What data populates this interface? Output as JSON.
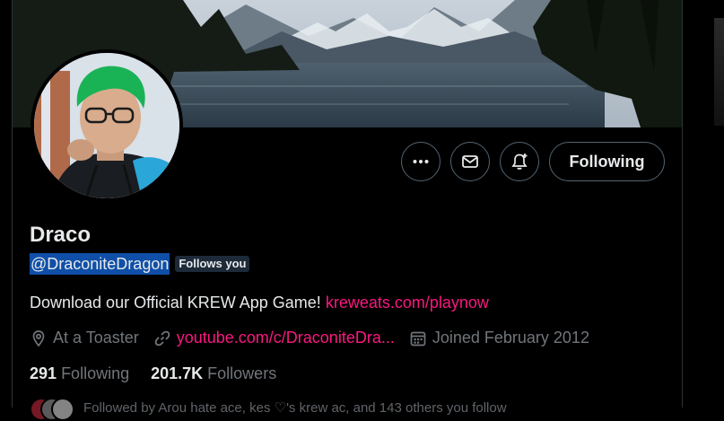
{
  "profile": {
    "name": "Draco",
    "handle": "@DraconiteDragon",
    "follows_you": "Follows you",
    "bio_text": "Download our Official KREW App Game!",
    "bio_link": "kreweats.com/playnow",
    "location": "At a Toaster",
    "website": "youtube.com/c/DraconiteDra...",
    "joined": "Joined February 2012",
    "following_count": "291",
    "following_label": "Following",
    "followers_count": "201.7K",
    "followers_label": "Followers",
    "followed_by": "Followed by Arou hate ace, kes ♡'s krew ac, and 143 others you follow"
  },
  "actions": {
    "follow_button": "Following"
  },
  "icons": {
    "more": "more-horizontal-icon",
    "message": "envelope-icon",
    "notify": "bell-plus-icon",
    "location": "location-pin-icon",
    "link": "link-icon",
    "calendar": "calendar-icon"
  },
  "colors": {
    "background": "#000000",
    "text": "#e7e9ea",
    "muted": "#71767b",
    "link": "#f91880",
    "border": "#536471",
    "selection": "#0f4fa8"
  }
}
